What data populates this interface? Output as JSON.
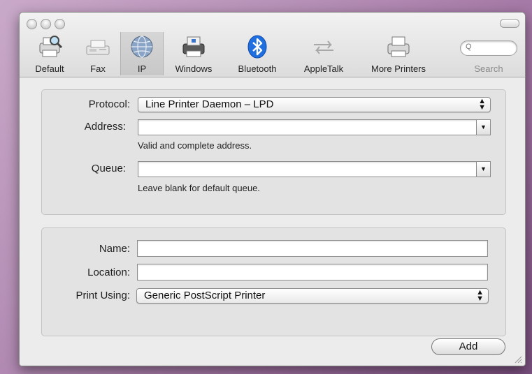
{
  "toolbar": {
    "items": [
      {
        "label": "Default",
        "icon": "printer-magnifier-icon"
      },
      {
        "label": "Fax",
        "icon": "fax-icon"
      },
      {
        "label": "IP",
        "icon": "globe-icon",
        "selected": true
      },
      {
        "label": "Windows",
        "icon": "printer-windows-icon"
      },
      {
        "label": "Bluetooth",
        "icon": "bluetooth-icon"
      },
      {
        "label": "AppleTalk",
        "icon": "appletalk-arrows-icon"
      },
      {
        "label": "More Printers",
        "icon": "printer-icon"
      }
    ],
    "search_label": "Search",
    "search_value": "",
    "search_glyph": "Q"
  },
  "connection": {
    "protocol_label": "Protocol:",
    "protocol_value": "Line Printer Daemon – LPD",
    "address_label": "Address:",
    "address_value": "",
    "address_hint": "Valid and complete address.",
    "queue_label": "Queue:",
    "queue_value": "",
    "queue_hint": "Leave blank for default queue."
  },
  "printer": {
    "name_label": "Name:",
    "name_value": "",
    "location_label": "Location:",
    "location_value": "",
    "print_using_label": "Print Using:",
    "print_using_value": "Generic PostScript Printer"
  },
  "actions": {
    "add_label": "Add"
  },
  "colors": {
    "bluetooth": "#1f6fe0",
    "window_bg": "#ececec"
  }
}
